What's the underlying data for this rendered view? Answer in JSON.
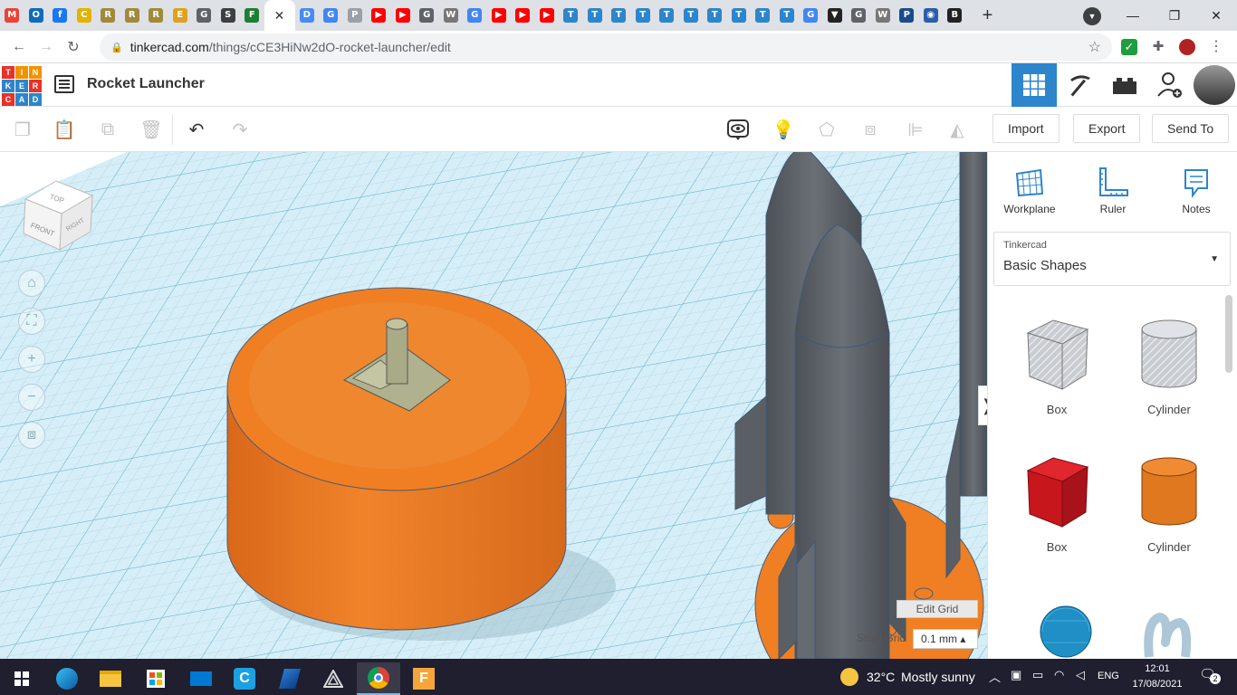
{
  "browser": {
    "tab_close_glyph": "✕",
    "new_tab_glyph": "+",
    "url_host": "tinkercad.com",
    "url_path": "/things/cCE3HiNw2dO-rocket-launcher/edit",
    "tab_favicons": [
      {
        "icon": "gmail-icon",
        "color": "#ea4335",
        "glyph": "M"
      },
      {
        "icon": "outlook-icon",
        "color": "#0f6cbd",
        "glyph": "O"
      },
      {
        "icon": "facebook-icon",
        "color": "#1877f2",
        "glyph": "f"
      },
      {
        "icon": "coin-icon",
        "color": "#e3b300",
        "glyph": "C"
      },
      {
        "icon": "robot-icon",
        "color": "#a08a3a",
        "glyph": "R"
      },
      {
        "icon": "robot-icon",
        "color": "#a08a3a",
        "glyph": "R"
      },
      {
        "icon": "robot-icon",
        "color": "#a08a3a",
        "glyph": "R"
      },
      {
        "icon": "emoji-icon",
        "color": "#e0a020",
        "glyph": "E"
      },
      {
        "icon": "globe-icon",
        "color": "#5f6368",
        "glyph": "G"
      },
      {
        "icon": "shield-icon",
        "color": "#3c4043",
        "glyph": "S"
      },
      {
        "icon": "f-icon",
        "color": "#1e7e34",
        "glyph": "F"
      }
    ],
    "tab_favicons_after": [
      {
        "icon": "docs-icon",
        "color": "#4a8af4",
        "glyph": "D"
      },
      {
        "icon": "google-icon",
        "color": "#4285f4",
        "glyph": "G"
      },
      {
        "icon": "page-icon",
        "color": "#9aa0a6",
        "glyph": "P"
      },
      {
        "icon": "youtube-icon",
        "color": "#ff0000",
        "glyph": "▶"
      },
      {
        "icon": "youtube-icon",
        "color": "#ff0000",
        "glyph": "▶"
      },
      {
        "icon": "globe-icon",
        "color": "#5f6368",
        "glyph": "G"
      },
      {
        "icon": "wikipedia-icon",
        "color": "#777777",
        "glyph": "W"
      },
      {
        "icon": "google-icon",
        "color": "#4285f4",
        "glyph": "G"
      },
      {
        "icon": "youtube-icon",
        "color": "#ff0000",
        "glyph": "▶"
      },
      {
        "icon": "youtube-icon",
        "color": "#ff0000",
        "glyph": "▶"
      },
      {
        "icon": "youtube-icon",
        "color": "#ff0000",
        "glyph": "▶"
      },
      {
        "icon": "tinkercad-icon",
        "color": "#2d85cb",
        "glyph": "T"
      },
      {
        "icon": "tinkercad-icon",
        "color": "#2d85cb",
        "glyph": "T"
      },
      {
        "icon": "tinkercad-icon",
        "color": "#2d85cb",
        "glyph": "T"
      },
      {
        "icon": "tinkercad-icon",
        "color": "#2d85cb",
        "glyph": "T"
      },
      {
        "icon": "tinkercad-icon",
        "color": "#2d85cb",
        "glyph": "T"
      },
      {
        "icon": "tinkercad-icon",
        "color": "#2d85cb",
        "glyph": "T"
      },
      {
        "icon": "tinkercad-icon",
        "color": "#2d85cb",
        "glyph": "T"
      },
      {
        "icon": "tinkercad-icon",
        "color": "#2d85cb",
        "glyph": "T"
      },
      {
        "icon": "tinkercad-icon",
        "color": "#2d85cb",
        "glyph": "T"
      },
      {
        "icon": "tinkercad-icon",
        "color": "#2d85cb",
        "glyph": "T"
      },
      {
        "icon": "google-icon",
        "color": "#4285f4",
        "glyph": "G"
      },
      {
        "icon": "shield-icon",
        "color": "#222222",
        "glyph": "▼"
      },
      {
        "icon": "globe-icon",
        "color": "#5f6368",
        "glyph": "G"
      },
      {
        "icon": "wikipedia-icon",
        "color": "#777777",
        "glyph": "W"
      },
      {
        "icon": "p2-icon",
        "color": "#1a4c8c",
        "glyph": "P"
      },
      {
        "icon": "eye-icon",
        "color": "#2b5ea8",
        "glyph": "◉"
      },
      {
        "icon": "bbc-icon",
        "color": "#222222",
        "glyph": "B"
      }
    ]
  },
  "app": {
    "logo_letters": [
      "T",
      "I",
      "N",
      "K",
      "E",
      "R",
      "C",
      "A",
      "D"
    ],
    "logo_colors": [
      "#e6332a",
      "#f39200",
      "#f39200",
      "#2d85cb",
      "#2d85cb",
      "#e6332a",
      "#e6332a",
      "#2d85cb",
      "#2d85cb"
    ],
    "project_title": "Rocket Launcher"
  },
  "toolbar": {
    "import_label": "Import",
    "export_label": "Export",
    "send_to_label": "Send To"
  },
  "workspace": {
    "viewcube_top": "TOP",
    "viewcube_front": "FRONT",
    "viewcube_right": "RIGHT",
    "edit_grid_label": "Edit Grid",
    "snap_grid_label": "Snap Grid",
    "snap_grid_value": "0.1 mm ▴",
    "collapse_glyph": "❭"
  },
  "panel": {
    "tools": [
      {
        "label": "Workplane",
        "icon": "workplane-icon"
      },
      {
        "label": "Ruler",
        "icon": "ruler-icon"
      },
      {
        "label": "Notes",
        "icon": "notes-icon"
      }
    ],
    "library_source": "Tinkercad",
    "library_name": "Basic Shapes",
    "shapes": [
      {
        "label": "Box",
        "color": "#c7c7cc",
        "kind": "hole-box"
      },
      {
        "label": "Cylinder",
        "color": "#c7c7cc",
        "kind": "hole-cylinder"
      },
      {
        "label": "Box",
        "color": "#d71920",
        "kind": "box"
      },
      {
        "label": "Cylinder",
        "color": "#e67e22",
        "kind": "cylinder"
      }
    ]
  },
  "taskbar": {
    "weather_temp": "32°C",
    "weather_desc": "Mostly sunny",
    "language": "ENG",
    "time": "12:01",
    "date": "17/08/2021",
    "notification_count": "2"
  }
}
